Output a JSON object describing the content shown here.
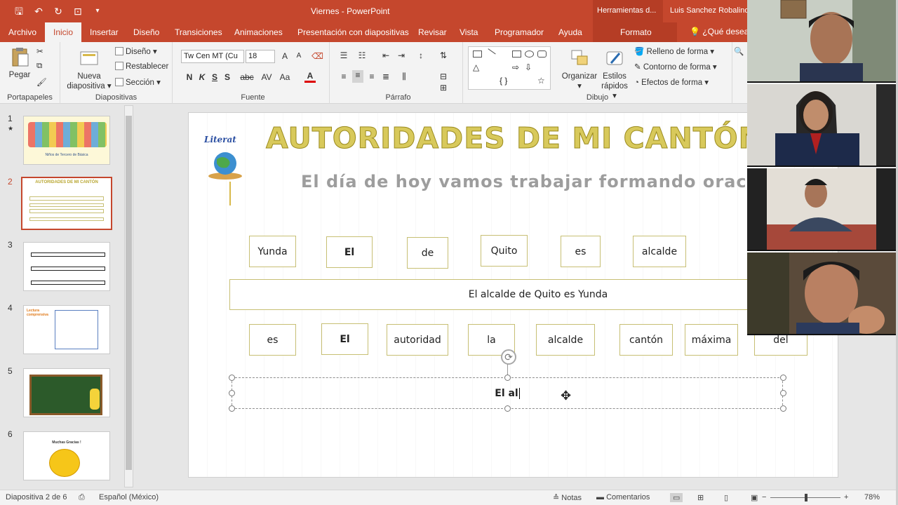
{
  "window": {
    "doc_title": "Viernes  -  PowerPoint",
    "context_tools": "Herramientas d...",
    "user": "Luis Sanchez Robalino"
  },
  "tabs": [
    "Archivo",
    "Inicio",
    "Insertar",
    "Diseño",
    "Transiciones",
    "Animaciones",
    "Presentación con diapositivas",
    "Revisar",
    "Vista",
    "Programador",
    "Ayuda"
  ],
  "context_tab": "Formato",
  "tell_me": "¿Qué desea",
  "ribbon": {
    "clipboard": {
      "paste": "Pegar",
      "label": "Portapapeles"
    },
    "slides": {
      "new_slide_1": "Nueva",
      "new_slide_2": "diapositiva",
      "layout": "Diseño",
      "reset": "Restablecer",
      "section": "Sección",
      "label": "Diapositivas"
    },
    "font": {
      "name": "Tw Cen MT (Cu",
      "size": "18",
      "bold": "N",
      "italic": "K",
      "underline": "S",
      "strike": "abc",
      "spacing": "AV",
      "case": "Aa",
      "color": "A",
      "grow": "A",
      "shrink": "A",
      "label": "Fuente"
    },
    "paragraph": {
      "label": "Párrafo"
    },
    "drawing": {
      "arrange": "Organizar",
      "quick_styles_1": "Estilos",
      "quick_styles_2": "rápidos",
      "fill": "Relleno de forma",
      "outline": "Contorno de forma",
      "effects": "Efectos de forma",
      "label": "Dibujo"
    }
  },
  "thumbnails": [
    {
      "num": "1",
      "star": "★"
    },
    {
      "num": "2"
    },
    {
      "num": "3"
    },
    {
      "num": "4"
    },
    {
      "num": "5"
    },
    {
      "num": "6"
    }
  ],
  "thumb_text": {
    "t1_caption": "Niños de Tercero de Básica",
    "t2_title": "AUTORIDADES DE MI CANTÓN",
    "t4_title": "Lectura comprensiva",
    "t6_text": "Muchas Gracias !"
  },
  "slide": {
    "logo_text": "Literat",
    "title": "AUTORIDADES DE MI CANTÓN",
    "subtitle": "El día de hoy vamos trabajar formando oraciones",
    "row1": [
      "Yunda",
      "El",
      "de",
      "Quito",
      "es",
      "alcalde"
    ],
    "sentence1": "El  alcalde de Quito es Yunda",
    "row2": [
      "es",
      "El",
      "autoridad",
      "la",
      "alcalde",
      "cantón",
      "máxima",
      "del"
    ],
    "answer": "El al"
  },
  "status": {
    "slide_of": "Diapositiva 2 de 6",
    "language": "Español (México)",
    "notes": "Notas",
    "comments": "Comentarios",
    "zoom": "78%"
  },
  "colors": {
    "accent": "#c5472d",
    "title_gold": "#d8c95b",
    "box_border": "#c7bf74"
  }
}
